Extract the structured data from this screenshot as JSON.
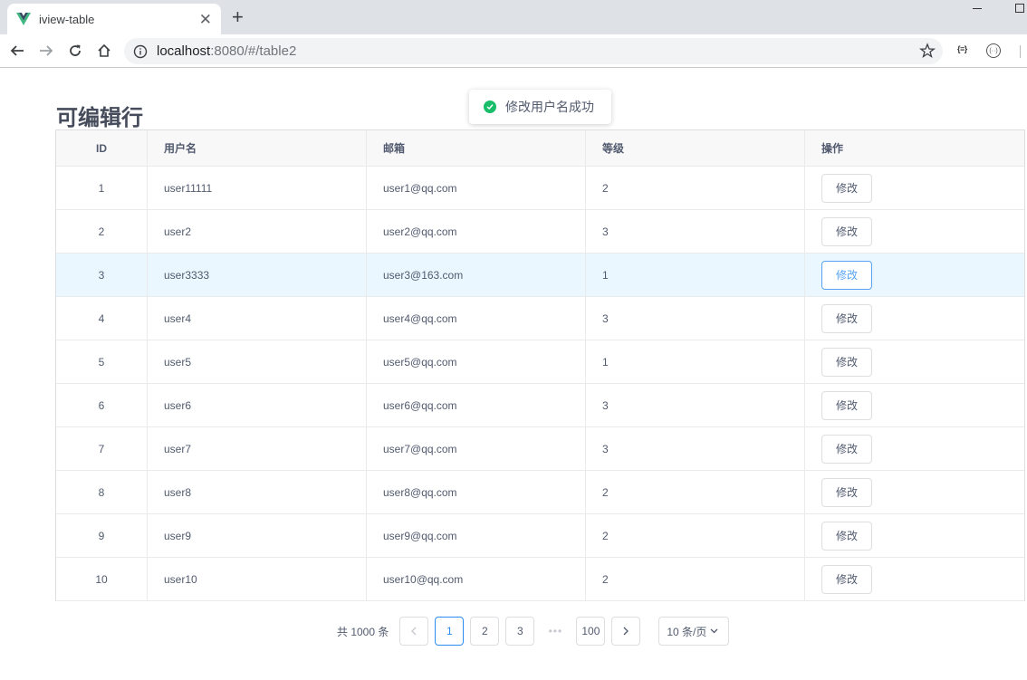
{
  "browser": {
    "tab_title": "iview-table",
    "url_host": "localhost",
    "url_rest": ":8080/#/table2",
    "ext_label": "{≡}",
    "ext2_label": "(··)"
  },
  "page": {
    "title": "可编辑行",
    "toast": "修改用户名成功"
  },
  "table": {
    "headers": [
      "ID",
      "用户名",
      "邮箱",
      "等级",
      "操作"
    ],
    "edit_label": "修改",
    "rows": [
      {
        "id": "1",
        "name": "user11111",
        "email": "user1@qq.com",
        "level": "2"
      },
      {
        "id": "2",
        "name": "user2",
        "email": "user2@qq.com",
        "level": "3"
      },
      {
        "id": "3",
        "name": "user3333",
        "email": "user3@163.com",
        "level": "1"
      },
      {
        "id": "4",
        "name": "user4",
        "email": "user4@qq.com",
        "level": "3"
      },
      {
        "id": "5",
        "name": "user5",
        "email": "user5@qq.com",
        "level": "1"
      },
      {
        "id": "6",
        "name": "user6",
        "email": "user6@qq.com",
        "level": "3"
      },
      {
        "id": "7",
        "name": "user7",
        "email": "user7@qq.com",
        "level": "3"
      },
      {
        "id": "8",
        "name": "user8",
        "email": "user8@qq.com",
        "level": "2"
      },
      {
        "id": "9",
        "name": "user9",
        "email": "user9@qq.com",
        "level": "2"
      },
      {
        "id": "10",
        "name": "user10",
        "email": "user10@qq.com",
        "level": "2"
      }
    ]
  },
  "pagination": {
    "total": "共 1000 条",
    "pages": [
      "1",
      "2",
      "3"
    ],
    "ellipsis": "•••",
    "last": "100",
    "page_size": "10 条/页"
  },
  "colors": {
    "accent": "#2d8cf0",
    "success": "#19be6b",
    "highlight_row": "#ebf7ff"
  }
}
